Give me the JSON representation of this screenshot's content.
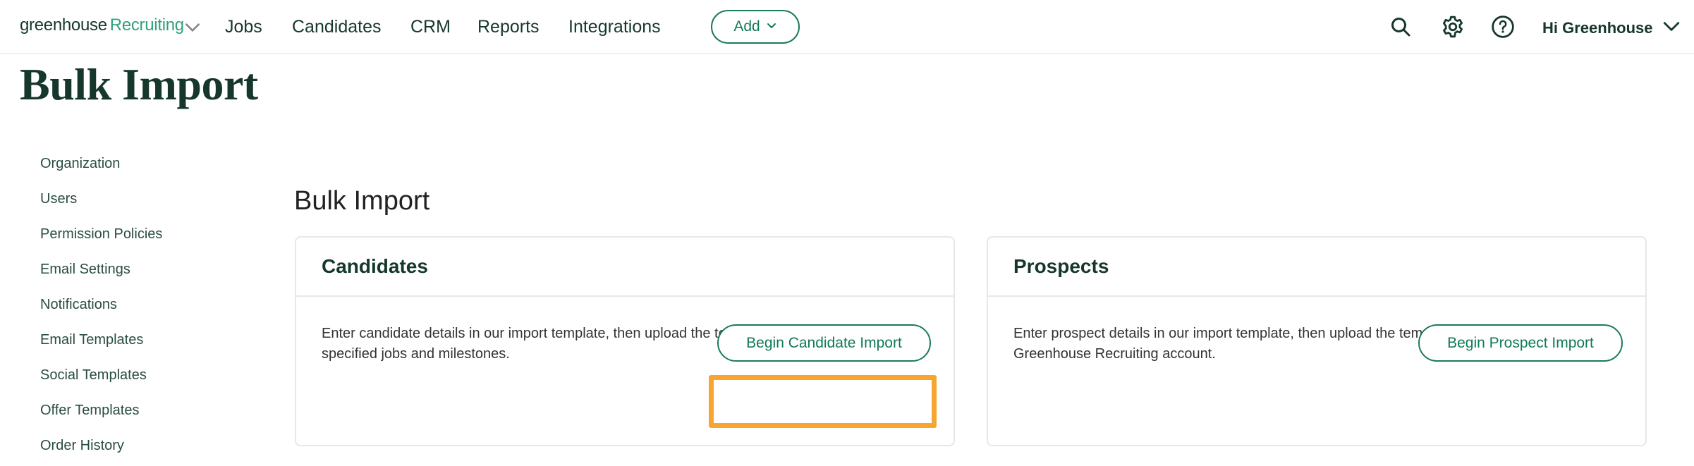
{
  "topnav": {
    "logo_brand": "greenhouse",
    "logo_product": "Recruiting",
    "items": [
      {
        "label": "Jobs"
      },
      {
        "label": "Candidates"
      },
      {
        "label": "CRM"
      },
      {
        "label": "Reports"
      },
      {
        "label": "Integrations"
      }
    ],
    "add_label": "Add",
    "icons": [
      "search-icon",
      "gear-icon",
      "help-icon"
    ],
    "user_label": "Hi Greenhouse"
  },
  "page_title": "Bulk Import",
  "sidebar": {
    "items": [
      {
        "label": "Organization"
      },
      {
        "label": "Users"
      },
      {
        "label": "Permission Policies"
      },
      {
        "label": "Email Settings"
      },
      {
        "label": "Notifications"
      },
      {
        "label": "Email Templates"
      },
      {
        "label": "Social Templates"
      },
      {
        "label": "Offer Templates"
      },
      {
        "label": "Order History"
      }
    ]
  },
  "main": {
    "section_title": "Bulk Import",
    "cards": [
      {
        "title": "Candidates",
        "description": "Enter candidate details in our import template, then upload the template to add candidates to specified jobs and milestones.",
        "button_label": "Begin Candidate Import",
        "highlighted": true
      },
      {
        "title": "Prospects",
        "description": "Enter prospect details in our import template, then upload the template to add prospects to your Greenhouse Recruiting account.",
        "button_label": "Begin Prospect Import",
        "highlighted": false
      }
    ]
  },
  "colors": {
    "brand_dark": "#15372c",
    "brand_green": "#2fa37a",
    "button_green": "#0f7a57",
    "highlight_orange": "#f8a530"
  }
}
